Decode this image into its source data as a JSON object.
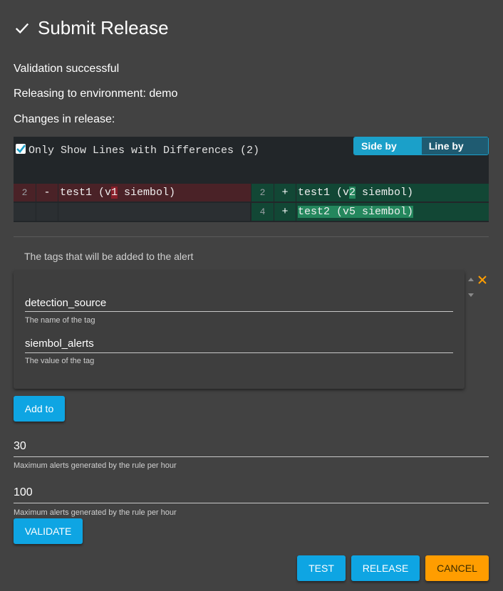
{
  "dialog": {
    "title": "Submit Release",
    "validation_status": "Validation successful",
    "releasing_to": "Releasing to environment: demo",
    "changes_label": "Changes in release:"
  },
  "diff": {
    "only_diff_label": "Only Show Lines with Differences (2)",
    "only_diff_checked": true,
    "view_modes": [
      "Side by Side",
      "Line by Line"
    ],
    "active_view": "Side by Side",
    "left": [
      {
        "line": "2",
        "sign": "-",
        "before": "test1 (v",
        "changed": "1",
        "after": " siembol)"
      }
    ],
    "right": [
      {
        "line": "2",
        "sign": "+",
        "before": "test1 (v",
        "changed": "2",
        "after": " siembol)"
      },
      {
        "line": "4",
        "sign": "+",
        "before": "",
        "changed": "test2 (v5 siembol)",
        "after": ""
      }
    ]
  },
  "tags": {
    "heading": "The tags that will be added to the alert",
    "name_value": "detection_source",
    "name_hint": "The name of the tag",
    "value_value": "siembol_alerts",
    "value_hint": "The value of the tag",
    "add_button": "Add to"
  },
  "limits": {
    "first_value": "30",
    "first_hint": "Maximum alerts generated by the rule per hour",
    "second_value": "100",
    "second_hint": "Maximum alerts generated by the rule per hour"
  },
  "actions": {
    "validate": "VALIDATE",
    "test": "TEST",
    "release": "RELEASE",
    "cancel": "CANCEL"
  },
  "colors": {
    "primary": "#0ea5e3",
    "accent": "#ff9d00",
    "background": "#424242"
  }
}
